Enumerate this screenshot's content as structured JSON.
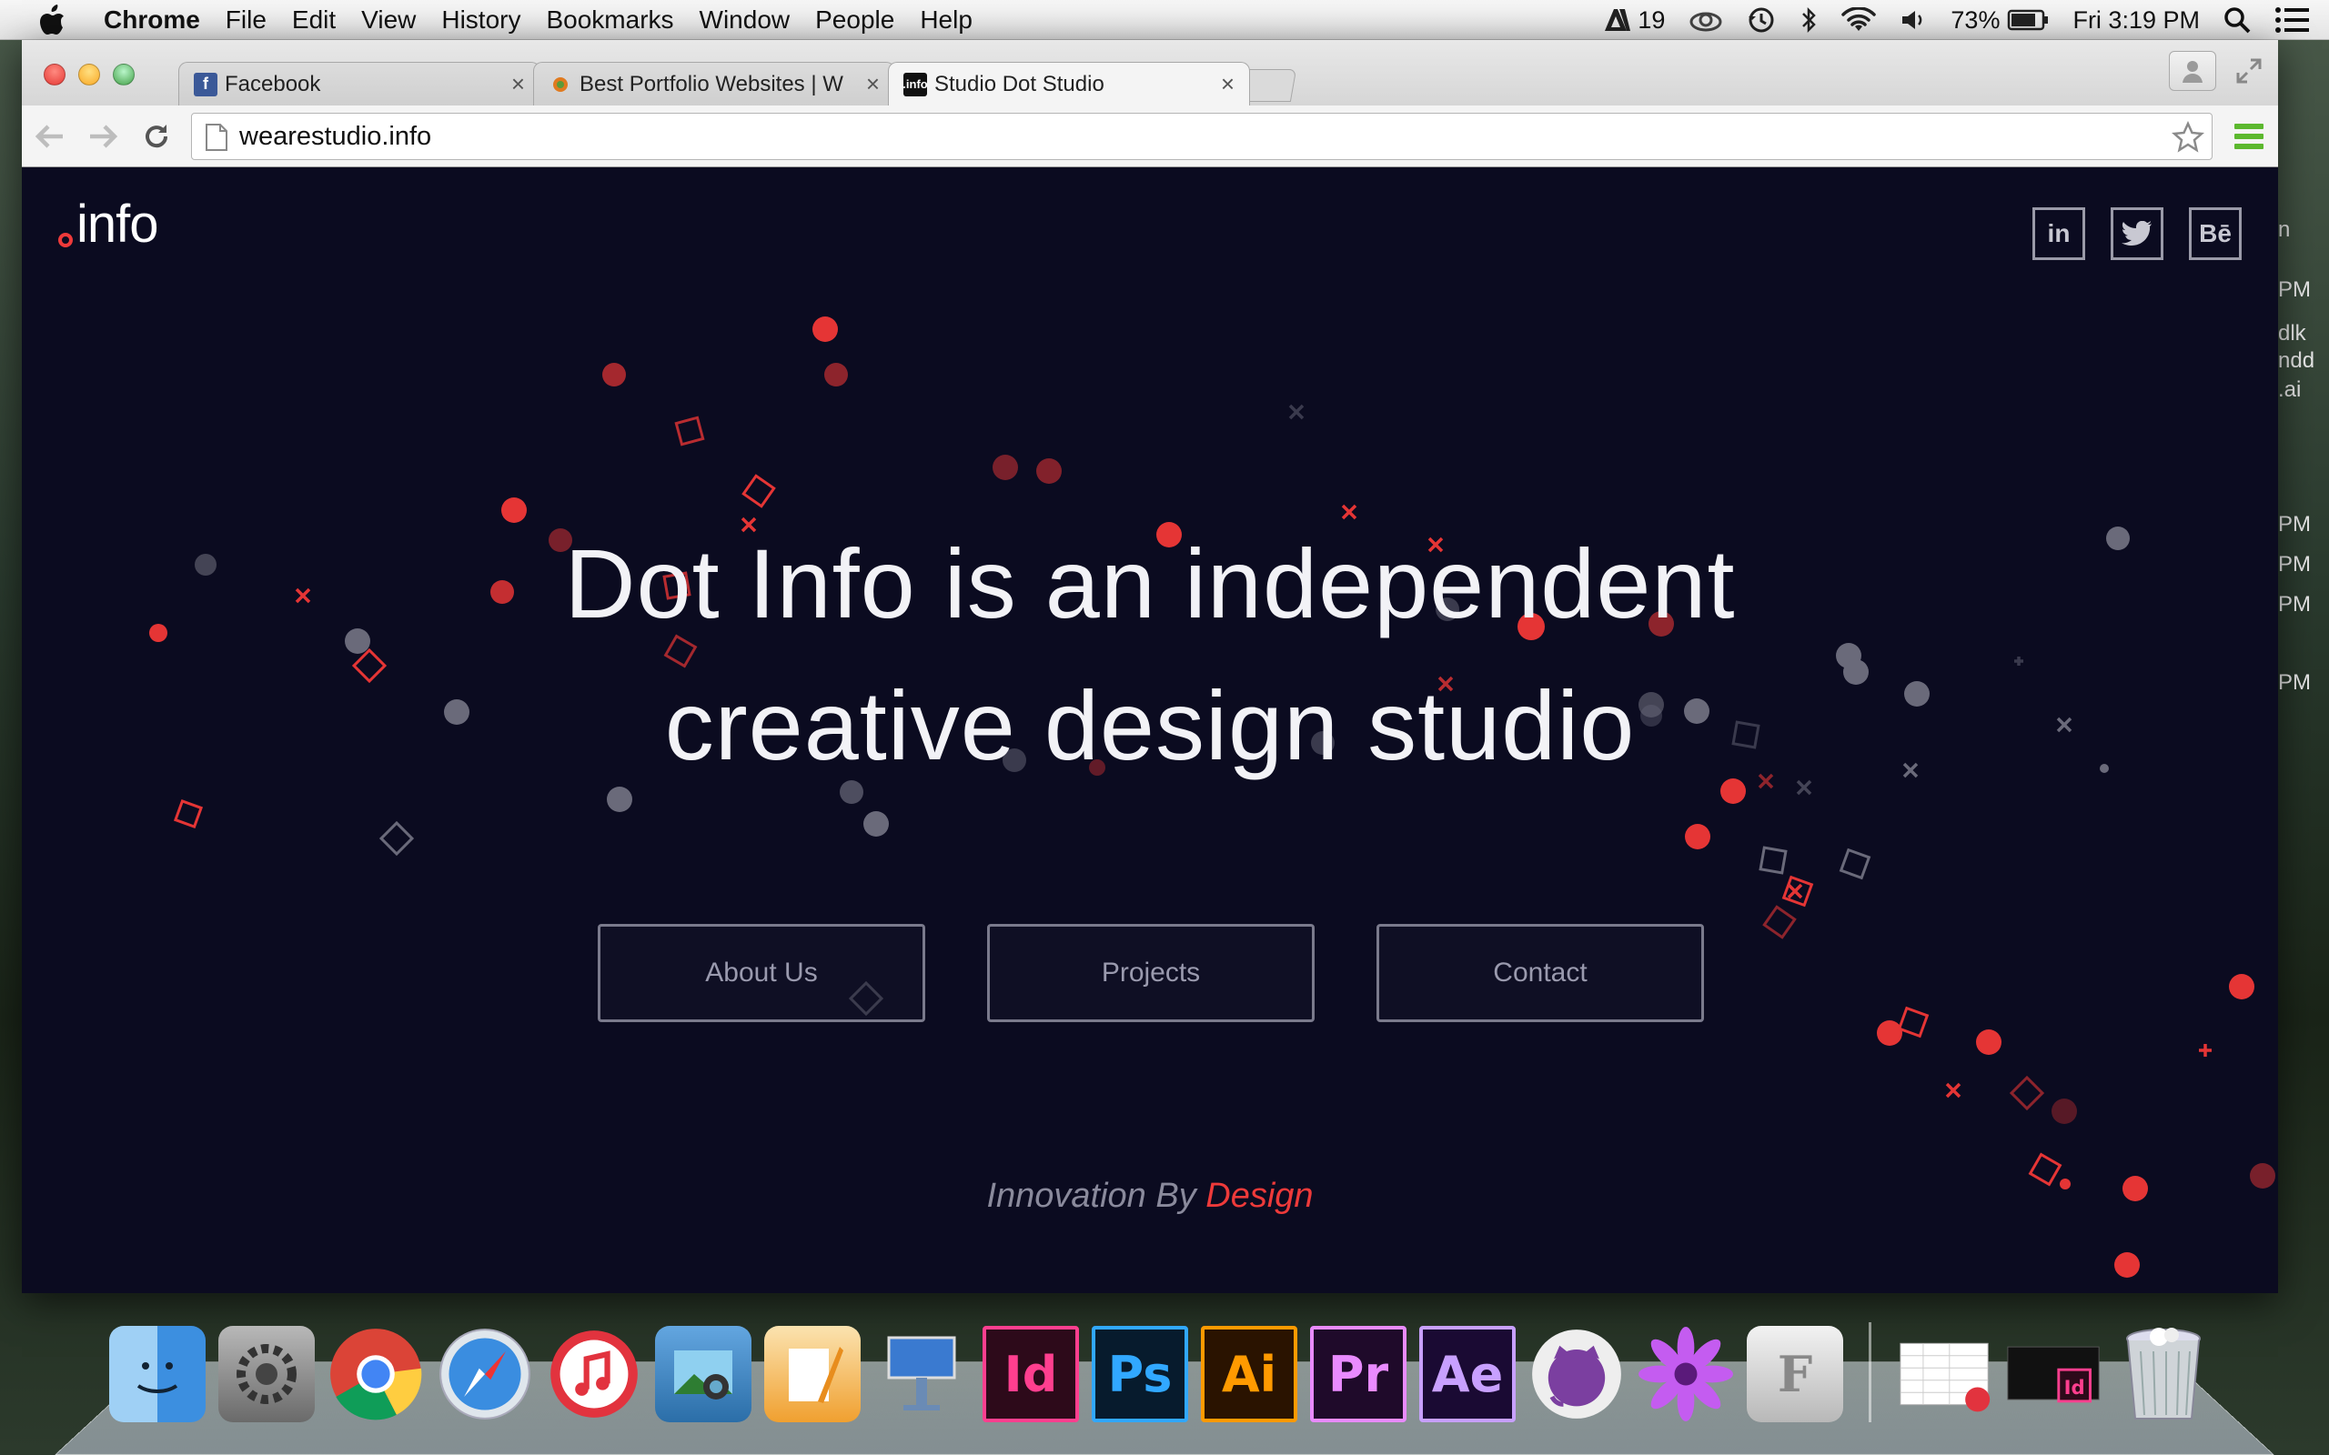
{
  "menubar": {
    "app_name": "Chrome",
    "menus": [
      "File",
      "Edit",
      "View",
      "History",
      "Bookmarks",
      "Window",
      "People",
      "Help"
    ],
    "adobe_count": "19",
    "battery": "73%",
    "clock": "Fri 3:19 PM"
  },
  "browser": {
    "tabs": [
      {
        "title": "Facebook",
        "icon": "facebook-icon"
      },
      {
        "title": "Best Portfolio Websites | W",
        "icon": "site-gear-icon"
      },
      {
        "title": "Studio Dot Studio",
        "icon": "info-logo-icon",
        "active": true
      }
    ],
    "url": "wearestudio.info"
  },
  "page": {
    "logo_text": "info",
    "social": [
      "in",
      "twitter",
      "Bē"
    ],
    "headline_line1": "Dot Info is an independent",
    "headline_line2": "creative design studio",
    "buttons": [
      "About Us",
      "Projects",
      "Contact"
    ],
    "tagline_prefix": "Innovation By ",
    "tagline_accent": "Design",
    "accent_color": "#ee3a3a",
    "background_color": "#0b0b20"
  },
  "background_peek": [
    "n",
    "PM",
    "dlk",
    "ndd",
    ".ai",
    "PM",
    "PM",
    "PM",
    "PM"
  ],
  "dock": {
    "apps": [
      "Finder",
      "System Preferences",
      "Chrome",
      "Safari",
      "iTunes",
      "iPhoto",
      "Pages",
      "Keynote",
      "InDesign",
      "Photoshop",
      "Illustrator",
      "Premiere",
      "After Effects",
      "GitHub",
      "Flower",
      "Font Book",
      "Documents",
      "Downloads",
      "Trash"
    ],
    "adobe_labels": [
      "Id",
      "Ps",
      "Ai",
      "Pr",
      "Ae"
    ]
  }
}
